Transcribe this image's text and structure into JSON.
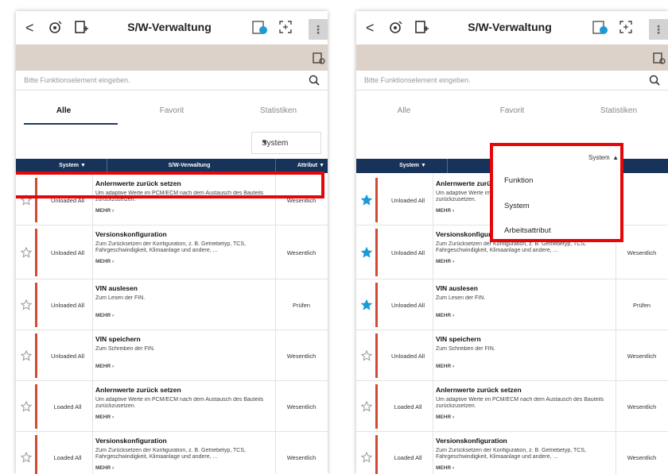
{
  "header": {
    "back": "<",
    "title": "S/W-Verwaltung",
    "menu": "⋮"
  },
  "search": {
    "placeholder": "Bitte Funktionselement eingeben."
  },
  "tabs": [
    "Alle",
    "Favorit",
    "Statistiken"
  ],
  "filter": {
    "selected": "System"
  },
  "columns": {
    "system": "System",
    "function": "S/W-Verwaltung",
    "attribute": "Attribut"
  },
  "more_label": "MEHR ›",
  "dropdown_options": [
    "Funktion",
    "System",
    "Arbeitsattribut"
  ],
  "left_rows": [
    {
      "system": "Unloaded All",
      "name": "Anlernwerte zurück setzen",
      "desc": "Um adaptive Werte im PCM/ECM nach dem Austausch des Bauteils zurückzusetzen.",
      "attr": "Wesentlich",
      "fav": false
    },
    {
      "system": "Unloaded All",
      "name": "Versionskonfiguration",
      "desc": "Zum Zurücksetzen der Konfiguration, z. B. Getriebetyp, TCS, Fahrgeschwindigkeit, Klimaanlage und andere, ...",
      "attr": "Wesentlich",
      "fav": false
    },
    {
      "system": "Unloaded All",
      "name": "VIN auslesen",
      "desc": "Zum Lesen der FIN.",
      "attr": "Prüfen",
      "fav": false
    },
    {
      "system": "Unloaded All",
      "name": "VIN speichern",
      "desc": "Zum Schreiben der FIN.",
      "attr": "Wesentlich",
      "fav": false
    },
    {
      "system": "Loaded All",
      "name": "Anlernwerte zurück setzen",
      "desc": "Um adaptive Werte im PCM/ECM nach dem Austausch des Bauteils zurückzusetzen.",
      "attr": "Wesentlich",
      "fav": false
    },
    {
      "system": "Loaded All",
      "name": "Versionskonfiguration",
      "desc": "Zum Zurücksetzen der Konfiguration, z. B. Getriebetyp, TCS, Fahrgeschwindigkeit, Klimaanlage und andere, ...",
      "attr": "Wesentlich",
      "fav": false
    }
  ],
  "right_rows": [
    {
      "system": "Unloaded All",
      "name": "Anlernwerte zurück setzen",
      "desc": "Um adaptive Werte im PCM/ECM nach dem Austausch des Bauteils zurückzusetzen.",
      "attr": "",
      "fav": true
    },
    {
      "system": "Unloaded All",
      "name": "Versionskonfiguration",
      "desc": "Zum Zurücksetzen der Konfiguration, z. B. Getriebetyp, TCS, Fahrgeschwindigkeit, Klimaanlage und andere, ...",
      "attr": "Wesentlich",
      "fav": true
    },
    {
      "system": "Unloaded All",
      "name": "VIN auslesen",
      "desc": "Zum Lesen der FIN.",
      "attr": "Prüfen",
      "fav": true
    },
    {
      "system": "Unloaded All",
      "name": "VIN speichern",
      "desc": "Zum Schreiben der FIN.",
      "attr": "Wesentlich",
      "fav": false
    },
    {
      "system": "Loaded All",
      "name": "Anlernwerte zurück setzen",
      "desc": "Um adaptive Werte im PCM/ECM nach dem Austausch des Bauteils zurückzusetzen.",
      "attr": "Wesentlich",
      "fav": false
    },
    {
      "system": "Loaded All",
      "name": "Versionskonfiguration",
      "desc": "Zum Zurücksetzen der Konfiguration, z. B. Getriebetyp, TCS, Fahrgeschwindigkeit, Klimaanlage und andere, ...",
      "attr": "Wesentlich",
      "fav": false
    }
  ],
  "colors": {
    "accent": "#17335a",
    "highlight": "#e6060a",
    "bar": "#d14a34",
    "star": "#1a9ad6"
  }
}
